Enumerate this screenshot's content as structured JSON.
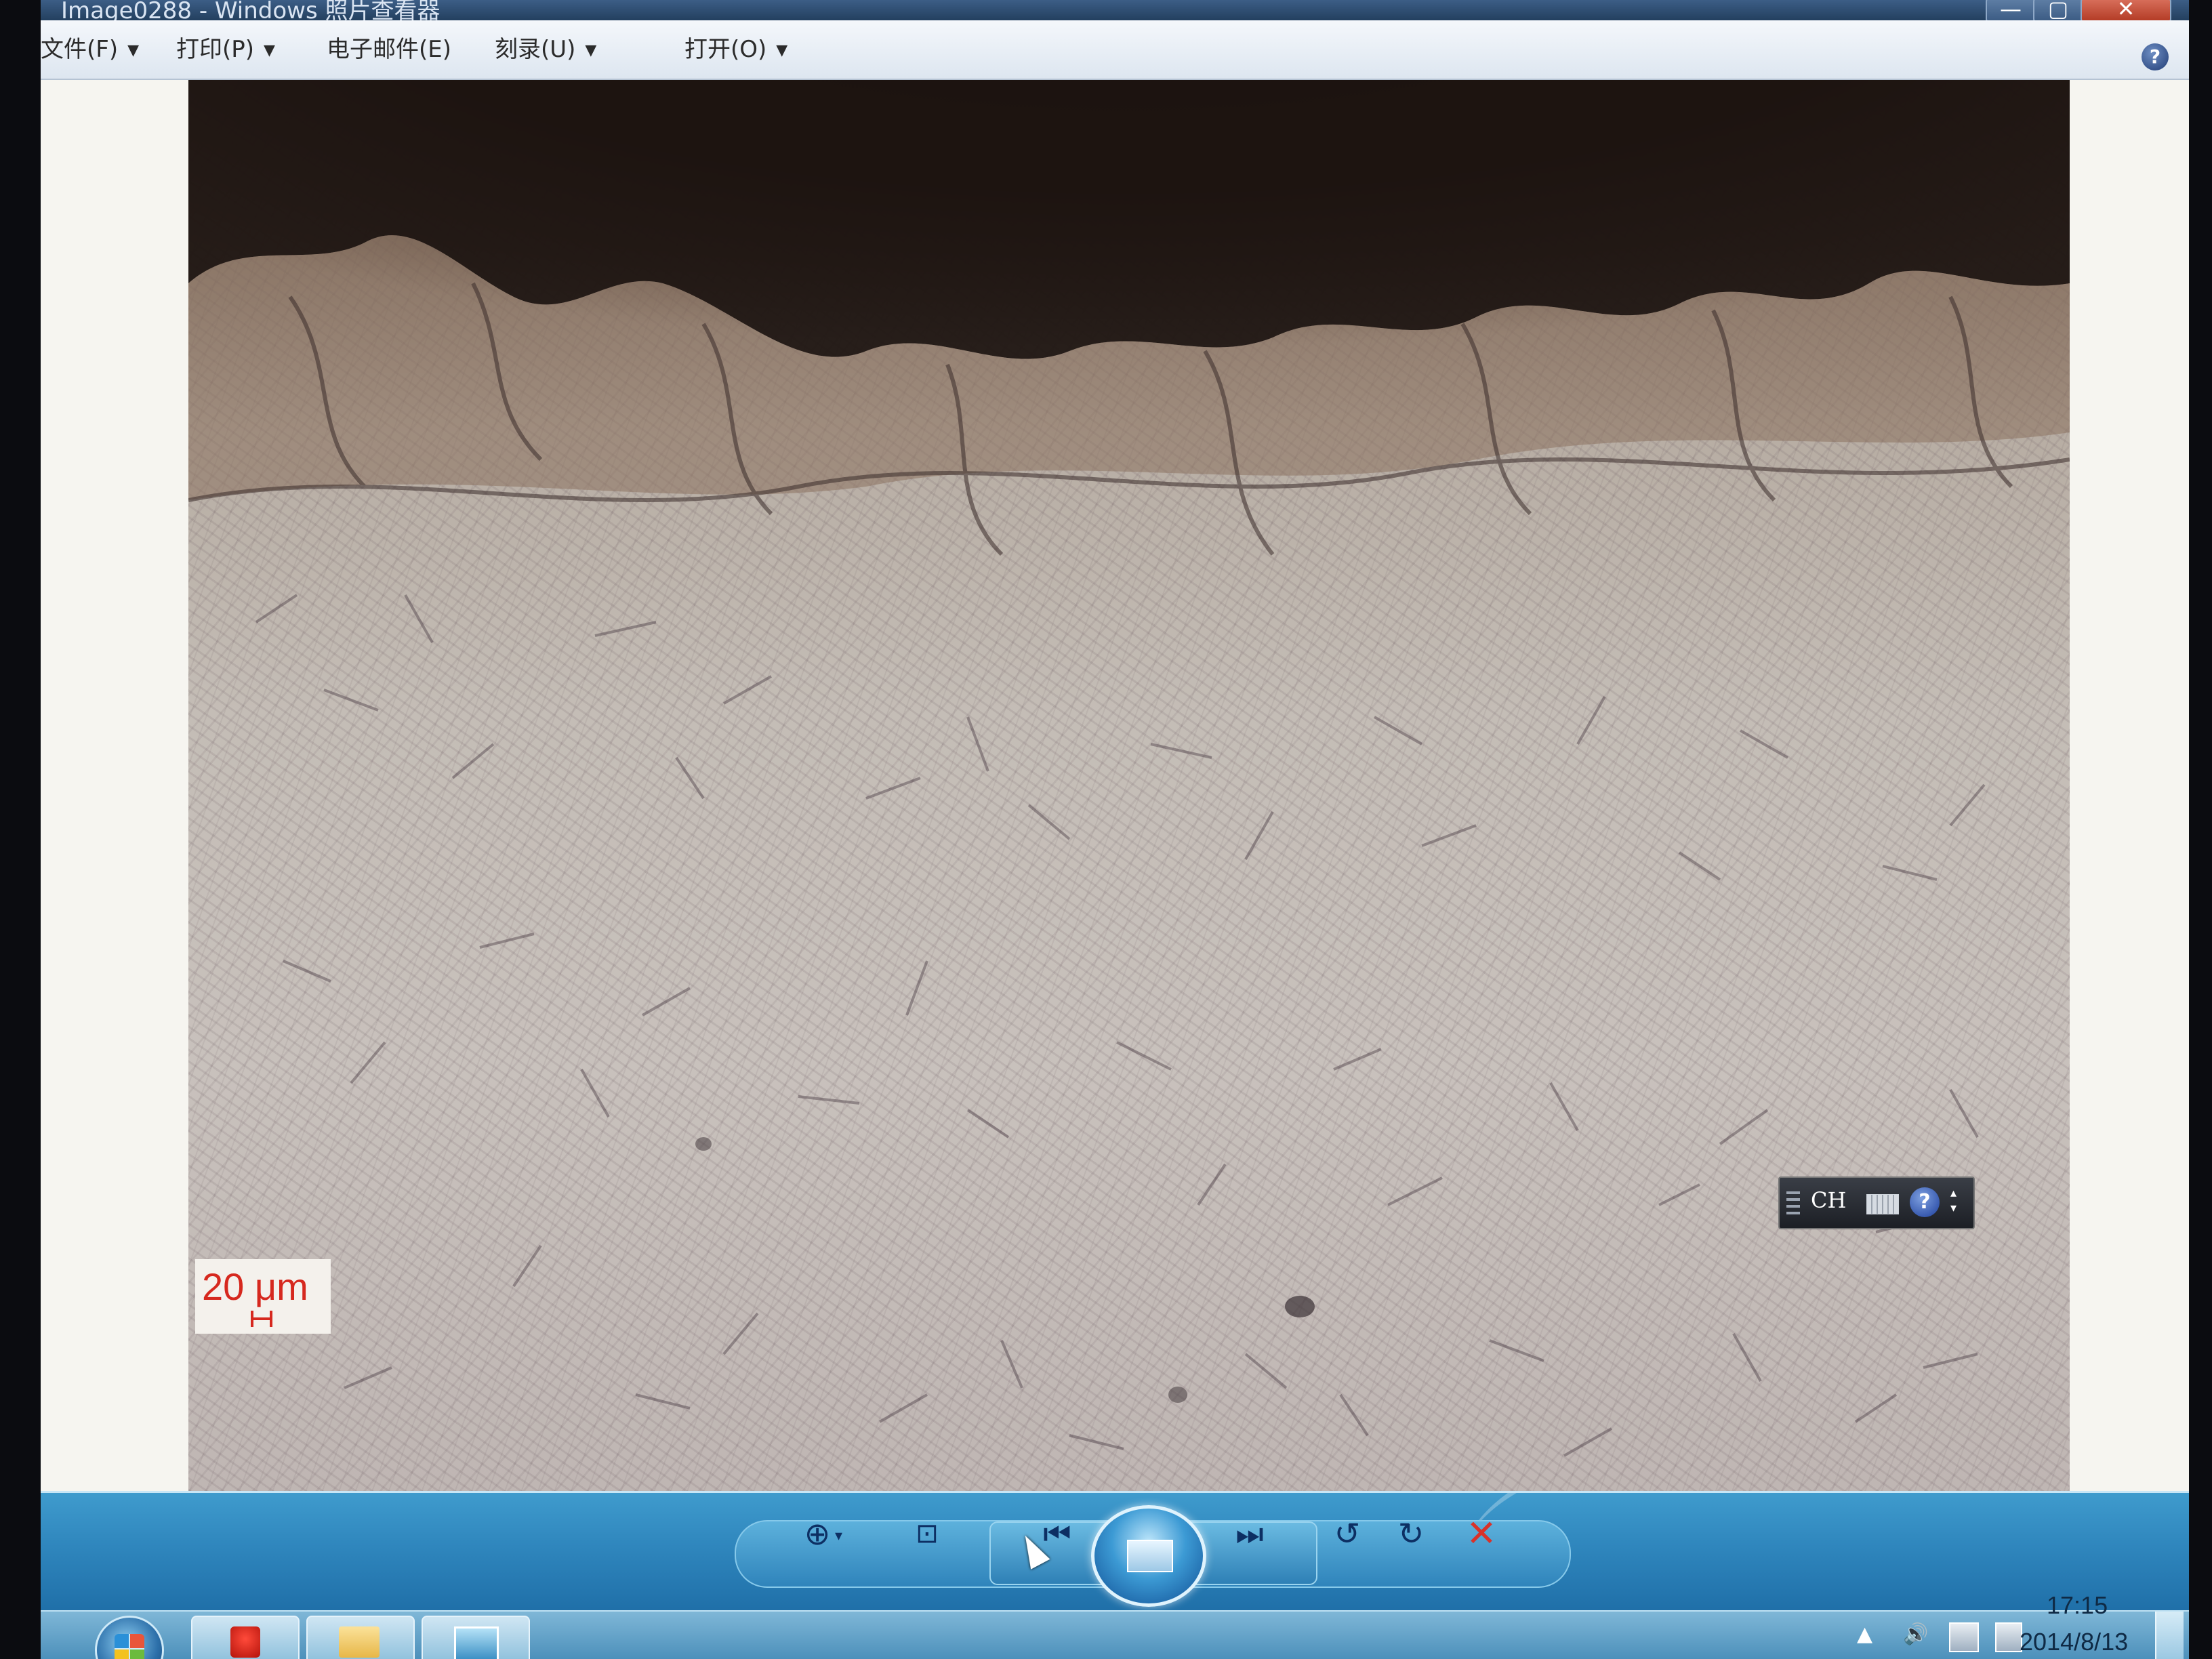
{
  "window": {
    "title": "Image0288 - Windows 照片查看器",
    "min_label": "—",
    "max_label": "▢",
    "close_label": "✕"
  },
  "menu": {
    "items": [
      {
        "label": "文件(F)",
        "has_dropdown": true
      },
      {
        "label": "打印(P)",
        "has_dropdown": true
      },
      {
        "label": "电子邮件(E)",
        "has_dropdown": false
      },
      {
        "label": "刻录(U)",
        "has_dropdown": true
      },
      {
        "label": "打开(O)",
        "has_dropdown": true
      }
    ],
    "help_label": "?"
  },
  "viewer": {
    "scale_bar": {
      "text": "20 μm",
      "color": "#d6281e"
    }
  },
  "language_bar": {
    "code": "CH",
    "help": "?"
  },
  "controls": {
    "zoom_icon": "zoom-icon",
    "fit_icon": "fit-to-window-icon",
    "prev_icon": "previous-icon",
    "slideshow_icon": "slideshow-icon",
    "next_icon": "next-icon",
    "rotate_left_icon": "rotate-counterclockwise-icon",
    "rotate_right_icon": "rotate-clockwise-icon",
    "delete_icon": "delete-icon",
    "glyphs": {
      "zoom": "⊕",
      "zoom_dd": "▾",
      "fit": "⊡",
      "prev": "⏮",
      "next": "⏭",
      "rotl": "↺",
      "rotr": "↻",
      "del": "✕"
    }
  },
  "taskbar": {
    "clock_time": "17:15",
    "clock_date": "2014/8/13",
    "tray_up": "▲",
    "tray_volume": "🔊"
  },
  "colors": {
    "control_bar": "#2f86bd",
    "accent": "#d6281e"
  }
}
